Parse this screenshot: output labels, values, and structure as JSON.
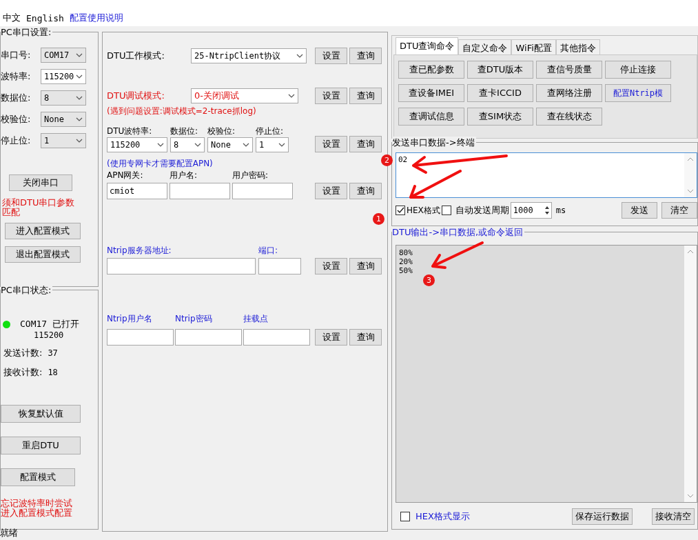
{
  "menu": [
    {
      "label": "中文",
      "kind": "plain"
    },
    {
      "label": "English",
      "kind": "plain"
    },
    {
      "label": "配置使用说明",
      "kind": "link"
    }
  ],
  "pc_serial_settings": {
    "title": "PC串口设置:",
    "fields": [
      {
        "label": "串口号:",
        "value": "COM17"
      },
      {
        "label": "波特率:",
        "value": "115200"
      },
      {
        "label": "数据位:",
        "value": "8"
      },
      {
        "label": "校验位:",
        "value": "None"
      },
      {
        "label": "停止位:",
        "value": "1"
      }
    ],
    "close_button": "关闭串口",
    "note": "须和DTU串口参数匹配",
    "buttons": [
      "进入配置模式",
      "退出配置模式"
    ]
  },
  "pc_serial_status": {
    "title": "PC串口状态:",
    "connected": true,
    "port_line": "COM17 已打开",
    "baud": "115200",
    "counters": [
      {
        "label": "发送计数:",
        "value": "37"
      },
      {
        "label": "接收计数:",
        "value": "18"
      }
    ],
    "buttons": [
      "恢复默认值",
      "重启DTU",
      "配置模式"
    ],
    "note": "忘记波特率时尝试进入配置模式配置"
  },
  "dtu_settings": {
    "work_mode": {
      "label": "DTU工作模式:",
      "value": "25-NtripClient协议",
      "buttons": [
        "设置",
        "查询"
      ]
    },
    "debug_mode": {
      "label": "DTU调试模式:",
      "value": "0-关闭调试",
      "hint": "(遇到问题设置:调试模式=2-trace抓log)",
      "buttons": [
        "设置",
        "查询"
      ]
    },
    "dtu_serial": {
      "fields": [
        {
          "label": "DTU波特率:",
          "value": "115200"
        },
        {
          "label": "数据位:",
          "value": "8"
        },
        {
          "label": "校验位:",
          "value": "None"
        },
        {
          "label": "停止位:",
          "value": "1"
        }
      ],
      "buttons": [
        "设置",
        "查询"
      ]
    },
    "apn": {
      "hint": "(使用专网卡才需要配置APN)",
      "fields": [
        {
          "label": "APN网关:",
          "value": "cmiot"
        },
        {
          "label": "用户名:"
        },
        {
          "label": "用户密码:"
        }
      ],
      "buttons": [
        "设置",
        "查询"
      ]
    },
    "ntrip_server": {
      "fields": [
        {
          "label": "Ntrip服务器地址:"
        },
        {
          "label": "端口:"
        }
      ],
      "buttons": [
        "设置",
        "查询"
      ]
    },
    "ntrip_account": {
      "fields": [
        {
          "label": "Ntrip用户名"
        },
        {
          "label": "Ntrip密码"
        },
        {
          "label": "挂载点"
        }
      ],
      "buttons": [
        "设置",
        "查询"
      ]
    }
  },
  "command_tabs": [
    {
      "label": "DTU查询命令",
      "selected": true
    },
    {
      "label": "自定义命令",
      "selected": false
    },
    {
      "label": "WiFi配置",
      "selected": false
    },
    {
      "label": "其他指令",
      "selected": false
    }
  ],
  "commands": [
    {
      "label": "查已配参数",
      "kind": "query"
    },
    {
      "label": "查DTU版本",
      "kind": "query"
    },
    {
      "label": "查信号质量",
      "kind": "query"
    },
    {
      "label": "停止连接",
      "kind": "query"
    },
    {
      "label": "查设备IMEI",
      "kind": "query"
    },
    {
      "label": "查卡ICCID",
      "kind": "query"
    },
    {
      "label": "查网络注册",
      "kind": "query"
    },
    {
      "label": "配置Ntrip模",
      "kind": "config"
    },
    {
      "label": "查调试信息",
      "kind": "query"
    },
    {
      "label": "查SIM状态",
      "kind": "query"
    },
    {
      "label": "查在线状态",
      "kind": "query"
    }
  ],
  "send": {
    "title": "发送串口数据->终端",
    "value": "02",
    "hex": {
      "label": "HEX格式",
      "checked": true
    },
    "auto_send": {
      "label": "自动发送周期",
      "checked": false
    },
    "period": "1000",
    "unit": "ms",
    "buttons": [
      "发送",
      "清空"
    ]
  },
  "output": {
    "title": "DTU输出->串口数据,或命令返回",
    "lines": [
      "80%",
      "20%",
      "50%"
    ],
    "hex_display": {
      "label": "HEX格式显示",
      "checked": false
    },
    "buttons": [
      "保存运行数据",
      "接收清空"
    ]
  },
  "annotations": [
    "1",
    "2",
    "3"
  ],
  "status_bar": "就绪"
}
